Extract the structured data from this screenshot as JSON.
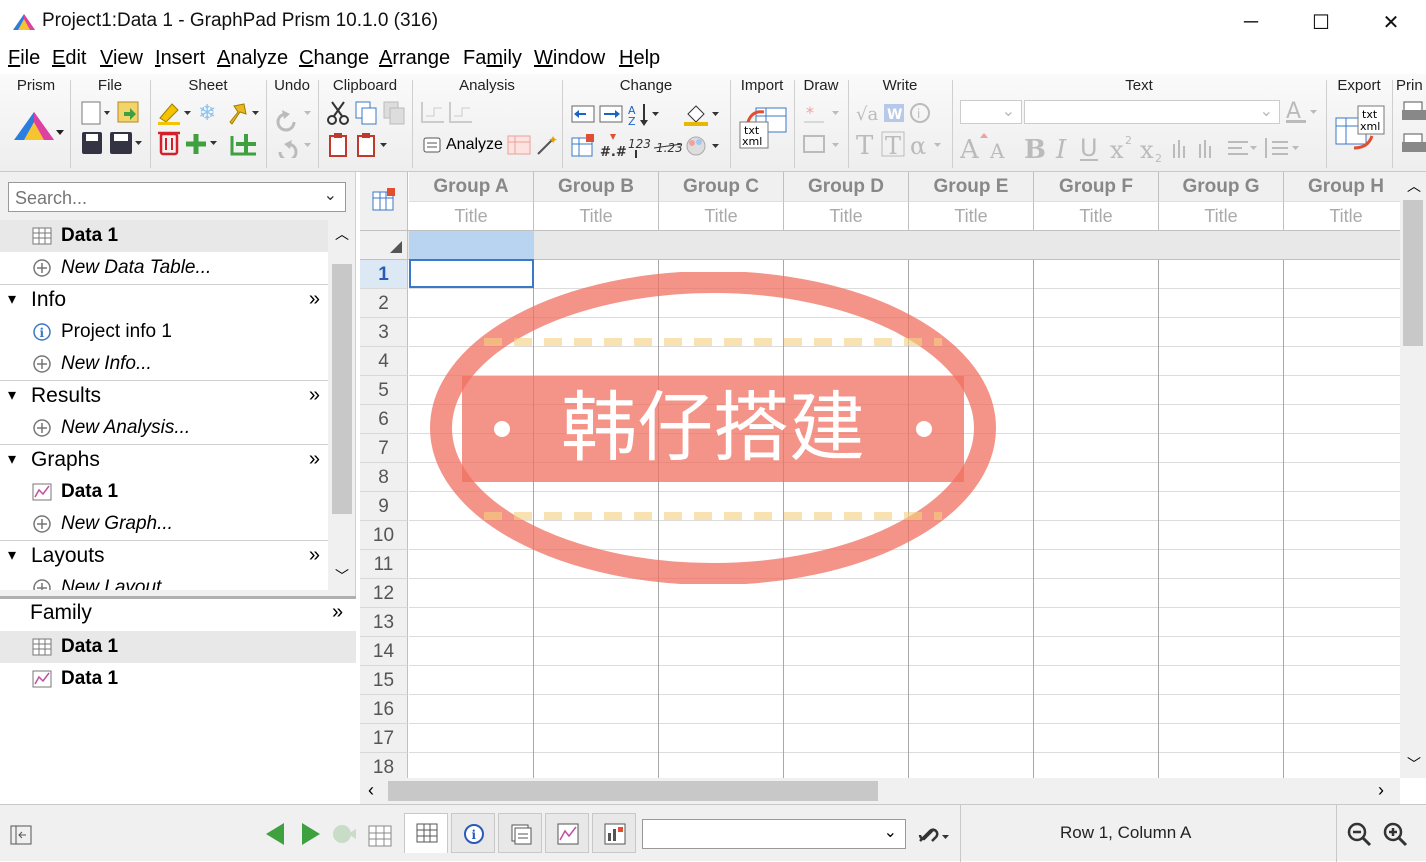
{
  "window": {
    "title": "Project1:Data 1 - GraphPad Prism 10.1.0 (316)",
    "minimize": "─",
    "maximize": "☐",
    "close": "✕"
  },
  "menu": [
    "File",
    "Edit",
    "View",
    "Insert",
    "Analyze",
    "Change",
    "Arrange",
    "Family",
    "Window",
    "Help"
  ],
  "menu_underline": [
    "F",
    "E",
    "V",
    "I",
    "A",
    "C",
    "A",
    "m",
    "W",
    "H"
  ],
  "ribbon": {
    "groups": [
      "Prism",
      "File",
      "Sheet",
      "Undo",
      "Clipboard",
      "Analysis",
      "Change",
      "Import",
      "Draw",
      "Write",
      "Text",
      "Export",
      "Prin"
    ],
    "analyze_label": "Analyze"
  },
  "sidebar": {
    "search_placeholder": "Search...",
    "data_tables": [
      {
        "label": "Data 1",
        "icon": "table-icon",
        "selected": true
      },
      {
        "label": "New Data Table...",
        "icon": "add-circle-icon"
      }
    ],
    "sections": [
      {
        "name": "Info",
        "items": [
          {
            "label": "Project info 1",
            "icon": "info-icon"
          },
          {
            "label": "New Info...",
            "icon": "add-circle-icon"
          }
        ]
      },
      {
        "name": "Results",
        "items": [
          {
            "label": "New Analysis...",
            "icon": "add-circle-icon"
          }
        ]
      },
      {
        "name": "Graphs",
        "items": [
          {
            "label": "Data 1",
            "icon": "graph-icon"
          },
          {
            "label": "New Graph...",
            "icon": "add-circle-icon"
          }
        ]
      },
      {
        "name": "Layouts",
        "items": [
          {
            "label": "New Layout...",
            "icon": "add-circle-icon"
          }
        ]
      }
    ],
    "more_glyph": "»",
    "family": {
      "title": "Family",
      "items": [
        {
          "label": "Data 1",
          "icon": "table-icon"
        },
        {
          "label": "Data 1",
          "icon": "graph-icon"
        }
      ]
    }
  },
  "sheet": {
    "columns": [
      "Group A",
      "Group B",
      "Group C",
      "Group D",
      "Group E",
      "Group F",
      "Group G",
      "Group H"
    ],
    "column_title_placeholder": "Title",
    "rows": [
      "1",
      "2",
      "3",
      "4",
      "5",
      "6",
      "7",
      "8",
      "9",
      "10",
      "11",
      "12",
      "13",
      "14",
      "15",
      "16",
      "17",
      "18"
    ],
    "selected_cell": "Row 1, Column A"
  },
  "watermark": {
    "text": "韩仔搭建",
    "color": "#f07060"
  },
  "status": {
    "position": "Row 1, Column A"
  }
}
